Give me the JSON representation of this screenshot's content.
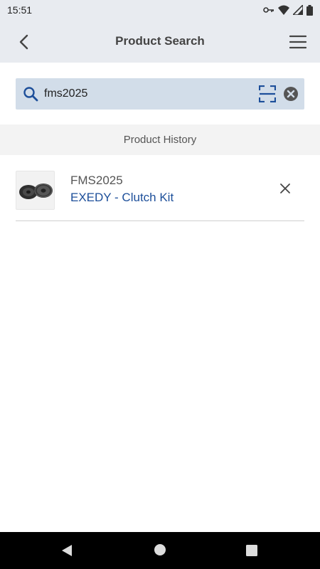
{
  "status_bar": {
    "time": "15:51",
    "icons": [
      "vpn-key-icon",
      "wifi-icon",
      "signal-icon",
      "battery-icon"
    ]
  },
  "header": {
    "title": "Product Search",
    "back_icon": "chevron-left-icon",
    "menu_icon": "hamburger-menu-icon"
  },
  "search": {
    "value": "fms2025",
    "placeholder": "",
    "search_icon": "search-icon",
    "scan_icon": "barcode-scan-icon",
    "clear_icon": "clear-icon"
  },
  "history": {
    "title": "Product History",
    "items": [
      {
        "code": "FMS2025",
        "name": "EXEDY - Clutch Kit",
        "thumbnail": "clutch-kit-image",
        "remove_icon": "close-icon"
      }
    ]
  },
  "colors": {
    "header_bg": "#e8ebf0",
    "search_bg": "#d2dde9",
    "accent": "#1d4f9a",
    "section_bg": "#f3f3f3"
  },
  "nav": {
    "icons": [
      "back-triangle-icon",
      "home-circle-icon",
      "recents-square-icon"
    ]
  }
}
